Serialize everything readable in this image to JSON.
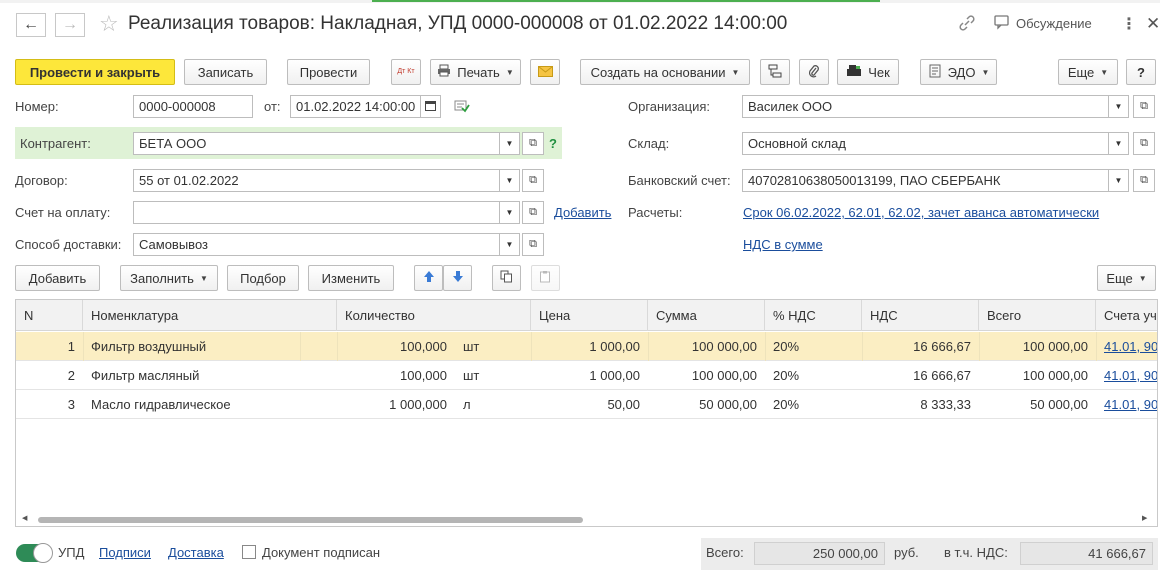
{
  "header": {
    "title": "Реализация товаров: Накладная, УПД 0000-000008 от 01.02.2022 14:00:00",
    "discussion": "Обсуждение"
  },
  "toolbar": {
    "post_close": "Провести и закрыть",
    "save": "Записать",
    "post": "Провести",
    "print": "Печать",
    "create_based": "Создать на основании",
    "check": "Чек",
    "edo": "ЭДО",
    "more": "Еще",
    "help": "?",
    "dtkt_icon_text": "Дт Кт"
  },
  "form": {
    "number_label": "Номер:",
    "number_value": "0000-000008",
    "date_label": "от:",
    "date_value": "01.02.2022 14:00:00",
    "org_label": "Организация:",
    "org_value": "Василек ООО",
    "contractor_label": "Контрагент:",
    "contractor_value": "БЕТА ООО",
    "help_mark": "?",
    "warehouse_label": "Склад:",
    "warehouse_value": "Основной склад",
    "contract_label": "Договор:",
    "contract_value": "55 от 01.02.2022",
    "bank_label": "Банковский счет:",
    "bank_value": "40702810638050013199, ПАО СБЕРБАНК",
    "invoice_label": "Счет на оплату:",
    "invoice_value": "",
    "invoice_add": "Добавить",
    "settlements_label": "Расчеты:",
    "settlements_link": "Срок 06.02.2022, 62.01, 62.02, зачет аванса автоматически",
    "delivery_label": "Способ доставки:",
    "delivery_value": "Самовывоз",
    "vat_link": "НДС в сумме"
  },
  "table_toolbar": {
    "add": "Добавить",
    "fill": "Заполнить",
    "pick": "Подбор",
    "change": "Изменить",
    "more": "Еще"
  },
  "table": {
    "columns": [
      "N",
      "Номенклатура",
      "Количество",
      "Цена",
      "Сумма",
      "% НДС",
      "НДС",
      "Всего",
      "Счета уч"
    ],
    "rows": [
      {
        "n": "1",
        "name": "Фильтр воздушный",
        "qty": "100,000",
        "unit": "шт",
        "price": "1 000,00",
        "sum": "100 000,00",
        "vat_rate": "20%",
        "vat": "16 666,67",
        "total": "100 000,00",
        "accounts": "41.01, 90"
      },
      {
        "n": "2",
        "name": "Фильтр масляный",
        "qty": "100,000",
        "unit": "шт",
        "price": "1 000,00",
        "sum": "100 000,00",
        "vat_rate": "20%",
        "vat": "16 666,67",
        "total": "100 000,00",
        "accounts": "41.01, 90"
      },
      {
        "n": "3",
        "name": "Масло гидравлическое",
        "qty": "1 000,000",
        "unit": "л",
        "price": "50,00",
        "sum": "50 000,00",
        "vat_rate": "20%",
        "vat": "8 333,33",
        "total": "50 000,00",
        "accounts": "41.01, 90"
      }
    ]
  },
  "footer": {
    "upd_label": "УПД",
    "signatures": "Подписи",
    "delivery": "Доставка",
    "signed_label": "Документ подписан",
    "total_label": "Всего:",
    "total_value": "250 000,00",
    "currency": "руб.",
    "vat_label": "в т.ч. НДС:",
    "vat_value": "41 666,67"
  },
  "colors": {
    "primary_button": "#fde73a",
    "selected_row": "#fbeec3",
    "contractor_highlight": "#dff2d6",
    "link": "#1a4d9c",
    "toggle_on": "#2e8b57"
  }
}
